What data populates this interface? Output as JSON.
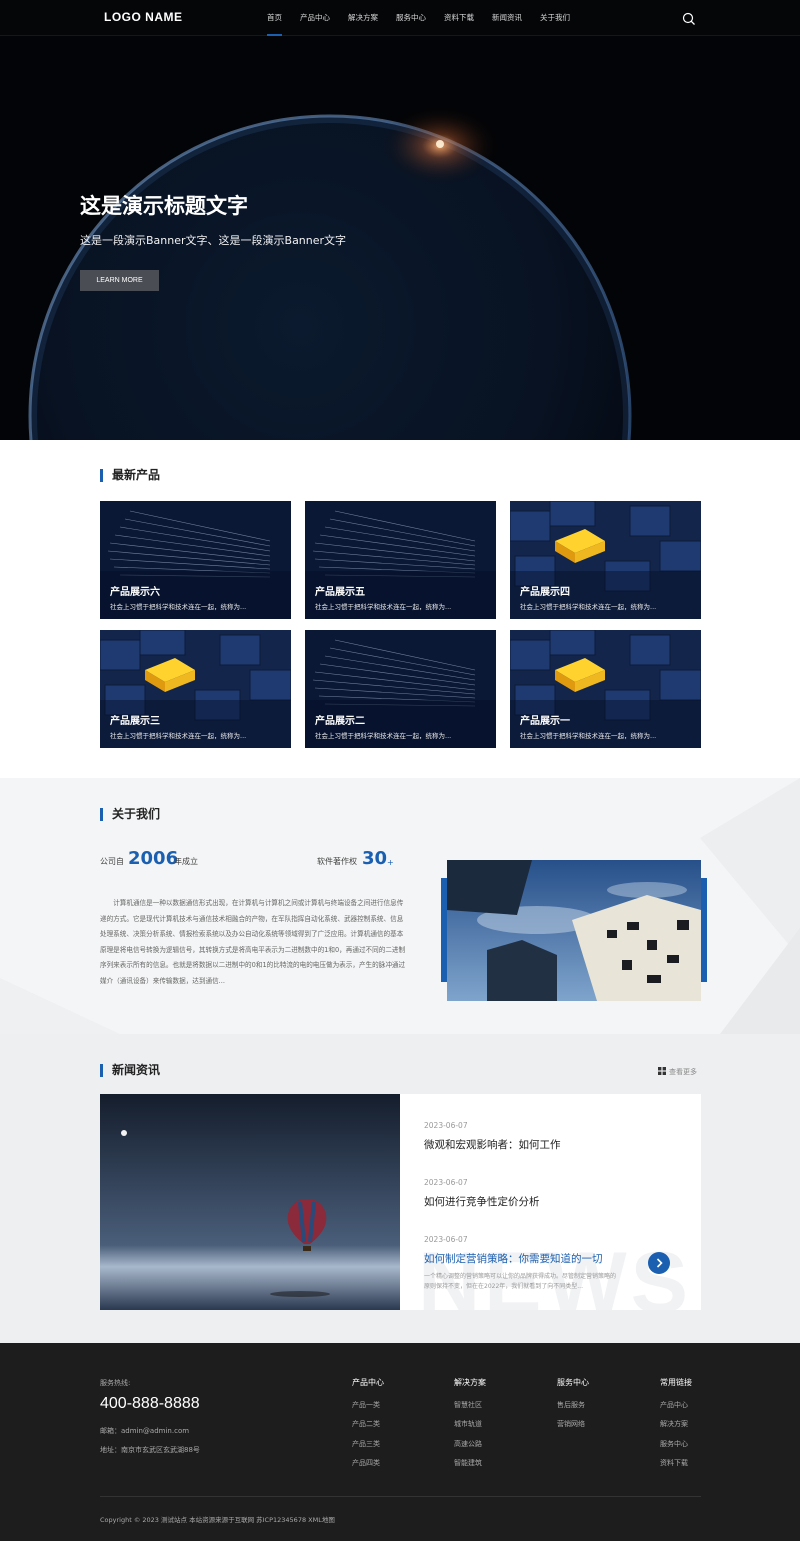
{
  "header": {
    "logo": "LOGO NAME",
    "nav": [
      "首页",
      "产品中心",
      "解决方案",
      "服务中心",
      "资料下载",
      "新闻资讯",
      "关于我们"
    ],
    "active_nav": 0
  },
  "banner": {
    "title": "这是演示标题文字",
    "subtitle": "这是一段演示Banner文字、这是一段演示Banner文字",
    "button": "LEARN MORE"
  },
  "products": {
    "title": "最新产品",
    "items": [
      {
        "name": "产品展示六",
        "desc": "社会上习惯于把科学和技术连在一起，统称为..."
      },
      {
        "name": "产品展示五",
        "desc": "社会上习惯于把科学和技术连在一起，统称为..."
      },
      {
        "name": "产品展示四",
        "desc": "社会上习惯于把科学和技术连在一起，统称为..."
      },
      {
        "name": "产品展示三",
        "desc": "社会上习惯于把科学和技术连在一起，统称为..."
      },
      {
        "name": "产品展示二",
        "desc": "社会上习惯于把科学和技术连在一起，统称为..."
      },
      {
        "name": "产品展示一",
        "desc": "社会上习惯于把科学和技术连在一起，统称为..."
      }
    ]
  },
  "about": {
    "title": "关于我们",
    "stat1_prefix": "公司自",
    "stat1_value": "2006",
    "stat1_suffix": "年成立",
    "stat2_prefix": "软件著作权",
    "stat2_value": "30",
    "stat2_suffix": "+",
    "text": "计算机通信是一种以数据通信形式出现，在计算机与计算机之间或计算机与终端设备之间进行信息传递的方式。它是现代计算机技术与通信技术相融合的产物，在军队指挥自动化系统、武器控制系统、信息处理系统、决策分析系统、情报检索系统以及办公自动化系统等领域得到了广泛应用。计算机通信的基本原理是将电信号转换为逻辑信号，其转换方式是将高电平表示为二进制数中的1和0，再通过不同的二进制序列来表示所有的信息。也就是将数据以二进制中的0和1的比特流的电的电压做为表示，产生的脉冲通过媒介（通讯设备）来传输数据，达到通信..."
  },
  "news": {
    "title": "新闻资讯",
    "more": "查看更多",
    "watermark": "NEWS",
    "items": [
      {
        "date": "2023-06-07",
        "title": "微观和宏观影响者：如何工作"
      },
      {
        "date": "2023-06-07",
        "title": "如何进行竞争性定价分析"
      },
      {
        "date": "2023-06-07",
        "title": "如何制定营销策略：你需要知道的一切",
        "summary": "一个精心调整的营销策略可以让你的品牌获得成功。尽管制定营销策略的原则保持不变，但在在2022年，我们就看到了向不同类型..."
      }
    ]
  },
  "footer": {
    "hotline_label": "服务热线:",
    "phone": "400-888-8888",
    "email": "邮箱：admin@admin.com",
    "address": "地址：南京市玄武区玄武湖88号",
    "columns": [
      {
        "title": "产品中心",
        "links": [
          "产品一类",
          "产品二类",
          "产品三类",
          "产品四类"
        ]
      },
      {
        "title": "解决方案",
        "links": [
          "智慧社区",
          "城市轨道",
          "高速公路",
          "智能建筑"
        ]
      },
      {
        "title": "服务中心",
        "links": [
          "售后服务",
          "营销网络"
        ]
      },
      {
        "title": "常用链接",
        "links": [
          "产品中心",
          "解决方案",
          "服务中心",
          "资料下载"
        ]
      }
    ],
    "copyright": "Copyright © 2023 测试站点 本站资源来源于互联网  苏ICP12345678  XML地图"
  },
  "colors": {
    "accent": "#1b5fb0",
    "header_bg": "#050608",
    "footer_bg": "#1d1d1d"
  }
}
